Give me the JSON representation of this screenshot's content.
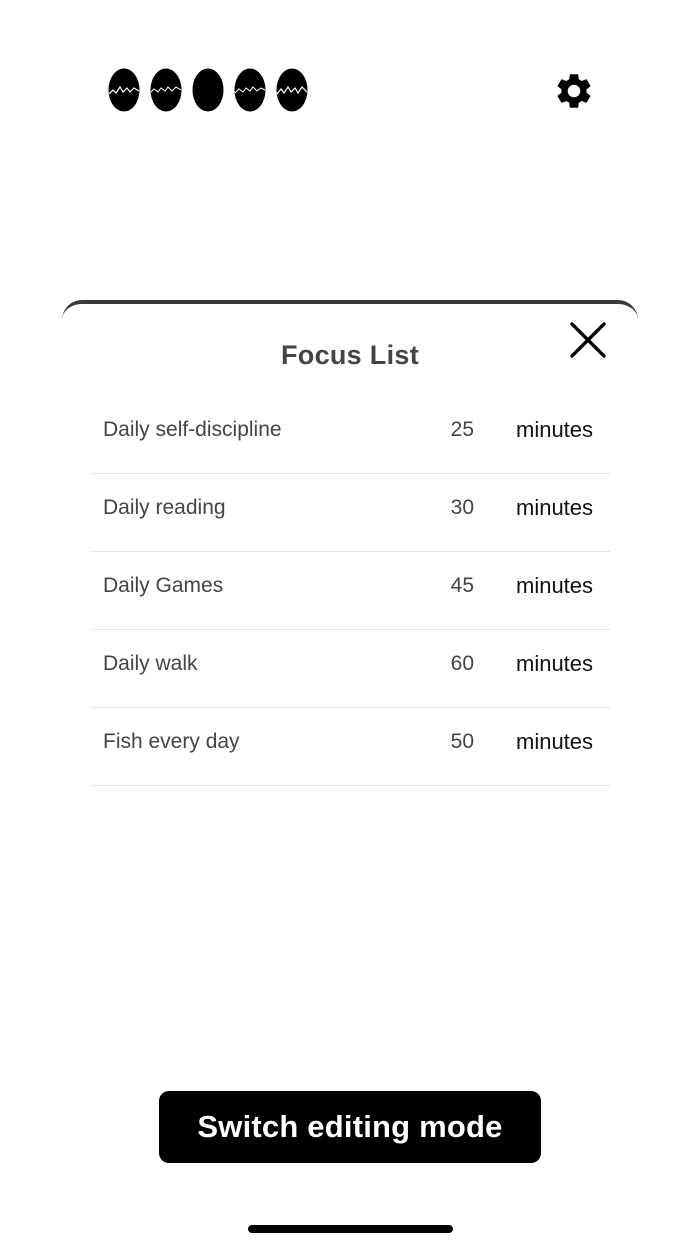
{
  "header": {
    "eggs": [
      {
        "icon": "cracked-egg-icon",
        "state": "cracked"
      },
      {
        "icon": "cracked-egg-icon",
        "state": "cracked"
      },
      {
        "icon": "egg-icon",
        "state": "whole"
      },
      {
        "icon": "cracked-egg-icon",
        "state": "cracked"
      },
      {
        "icon": "cracked-egg-icon",
        "state": "cracked"
      }
    ],
    "settings_icon": "gear-icon"
  },
  "sheet": {
    "title": "Focus List",
    "close_icon": "close-icon",
    "items": [
      {
        "name": "Daily self-discipline",
        "minutes": "25",
        "unit": "minutes"
      },
      {
        "name": "Daily reading",
        "minutes": "30",
        "unit": "minutes"
      },
      {
        "name": "Daily Games",
        "minutes": "45",
        "unit": "minutes"
      },
      {
        "name": "Daily walk",
        "minutes": "60",
        "unit": "minutes"
      },
      {
        "name": "Fish every day",
        "minutes": "50",
        "unit": "minutes"
      }
    ]
  },
  "footer": {
    "switch_label": "Switch editing mode"
  },
  "colors": {
    "background": "#ffffff",
    "primary": "#000000",
    "text": "#444444",
    "divider": "#e6e6e6"
  }
}
